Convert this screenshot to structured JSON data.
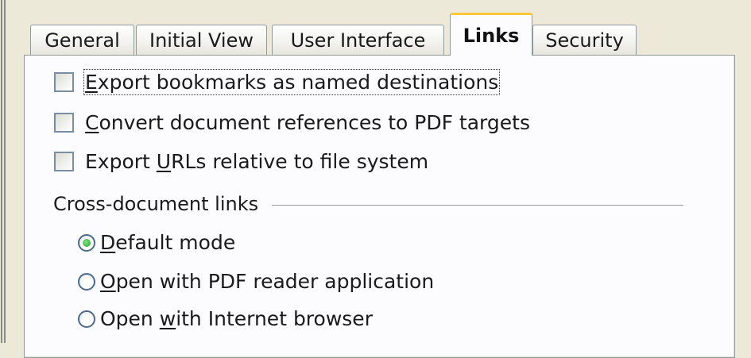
{
  "tabs": [
    {
      "label": "General",
      "active": false
    },
    {
      "label": "Initial View",
      "active": false
    },
    {
      "label": "User Interface",
      "active": false
    },
    {
      "label": "Links",
      "active": true
    },
    {
      "label": "Security",
      "active": false
    }
  ],
  "checkboxes": [
    {
      "pre": "",
      "mnemonic": "E",
      "post": "xport bookmarks as named destinations",
      "checked": false,
      "focused": true
    },
    {
      "pre": "",
      "mnemonic": "C",
      "post": "onvert document references to PDF targets",
      "checked": false,
      "focused": false
    },
    {
      "pre": "Export ",
      "mnemonic": "U",
      "post": "RLs relative to file system",
      "checked": false,
      "focused": false
    }
  ],
  "cross_doc": {
    "label": "Cross-document links",
    "options": [
      {
        "pre": "",
        "mnemonic": "D",
        "post": "efault mode",
        "selected": true
      },
      {
        "pre": "",
        "mnemonic": "O",
        "post": "pen with PDF reader application",
        "selected": false
      },
      {
        "pre": "Open ",
        "mnemonic": "w",
        "post": "ith Internet browser",
        "selected": false
      }
    ]
  },
  "colors": {
    "active_tab_accent": "#ffc83c",
    "radio_selected": "#21a121"
  }
}
